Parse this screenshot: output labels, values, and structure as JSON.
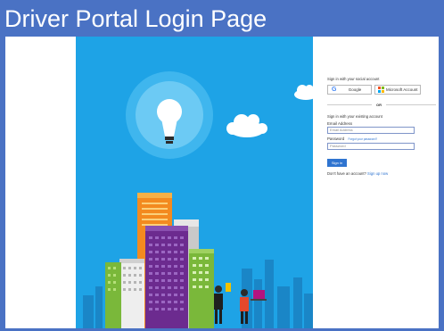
{
  "slide": {
    "title": "Driver Portal Login Page",
    "background_color": "#4a72c4"
  },
  "illustration": {
    "background_color": "#1ea3e6",
    "icons": [
      "lightbulb-icon",
      "cloud-icon",
      "city-buildings",
      "people-figures"
    ]
  },
  "login": {
    "social_heading": "Sign in with your social account",
    "google_label": "Google",
    "microsoft_label": "Microsoft Account",
    "or_label": "OR",
    "existing_heading": "Sign in with your existing account",
    "email_label": "Email Address",
    "email_placeholder": "Email Address",
    "password_label": "Password",
    "forgot_link": "Forgot your password?",
    "password_placeholder": "Password",
    "signin_button": "Sign in",
    "no_account_text": "Don't have an account?",
    "signup_link": "Sign up now"
  }
}
